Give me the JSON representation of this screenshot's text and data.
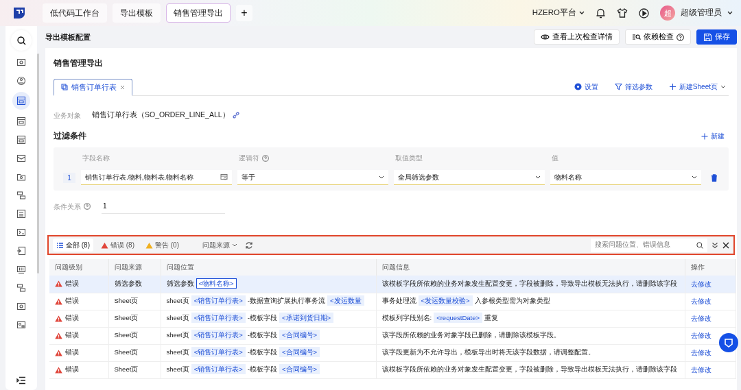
{
  "top_tabs": [
    {
      "label": "低代码工作台",
      "selected": false
    },
    {
      "label": "导出模板",
      "selected": false
    },
    {
      "label": "销售管理导出",
      "selected": true
    }
  ],
  "add_tab": "+",
  "platform": "HZERO平台",
  "user": {
    "avatar": "超",
    "name": "超级管理员"
  },
  "sidebar": {
    "items": [
      {
        "selected": false
      },
      {
        "selected": false
      },
      {
        "selected": true
      },
      {
        "selected": false
      },
      {
        "selected": false
      },
      {
        "selected": false
      },
      {
        "selected": false
      },
      {
        "selected": false
      },
      {
        "selected": false
      },
      {
        "selected": false
      },
      {
        "selected": false
      },
      {
        "selected": false
      },
      {
        "selected": false
      },
      {
        "selected": false
      },
      {
        "selected": false
      }
    ]
  },
  "page_title": "导出模板配置",
  "actions": [
    {
      "label": "查看上次检查详情",
      "kind": "eye"
    },
    {
      "label": "依赖检查",
      "kind": "check"
    },
    {
      "label": "保存",
      "kind": "primary"
    }
  ],
  "section_title": "销售管理导出",
  "sheet_tabs": [
    {
      "label": "销售订单行表",
      "selected": true
    }
  ],
  "sheet_actions": [
    {
      "label": "设置",
      "kind": "settings"
    },
    {
      "label": "筛选参数",
      "kind": "filter"
    },
    {
      "label": "新建Sheet页",
      "kind": "add"
    }
  ],
  "business_object": {
    "label": "业务对象",
    "value": "销售订单行表（SO_ORDER_LINE_ALL）"
  },
  "filter": {
    "title": "过滤条件",
    "add": "新建",
    "columns": [
      {
        "label": "字段名称",
        "help": false
      },
      {
        "label": "逻辑符",
        "help": true
      },
      {
        "label": "取值类型",
        "help": false
      },
      {
        "label": "值",
        "help": false
      }
    ],
    "rows": [
      {
        "index": "1",
        "field": "销售订单行表.物料,物料表.物料名称",
        "logic": "等于",
        "value_type": "全局筛选参数",
        "value": "物料名称"
      }
    ],
    "relation_label": "条件关系",
    "relation_value": "1"
  },
  "issues": {
    "filters": [
      {
        "label": "全部 (8)",
        "kind": "all",
        "selected": true
      },
      {
        "label": "错误 (8)",
        "kind": "error",
        "selected": false
      },
      {
        "label": "警告 (0)",
        "kind": "warning",
        "selected": false
      }
    ],
    "source_filter": "问题来源",
    "search_placeholder": "搜索问题位置、错误信息",
    "columns": [
      "问题级别",
      "问题来源",
      "问题位置",
      "问题信息",
      "操作"
    ],
    "rows": [
      {
        "level": "错误",
        "kind": "error",
        "source": "筛选参数",
        "selected": true,
        "location": [
          {
            "kind": "text",
            "text": "筛选参数"
          },
          {
            "kind": "tag",
            "text": "<物料名称>"
          }
        ],
        "message": [
          {
            "kind": "text",
            "text": "该模板字段所依赖的业务对象发生配置变更，字段被删除，导致导出模板无法执行，请删除该字段"
          }
        ],
        "action": "去修改"
      },
      {
        "level": "错误",
        "kind": "error",
        "source": "Sheet页",
        "selected": false,
        "location": [
          {
            "kind": "text",
            "text": "sheet页"
          },
          {
            "kind": "tag",
            "text": "<销售订单行表>"
          },
          {
            "kind": "text",
            "text": "-数据查询扩展执行事务流"
          },
          {
            "kind": "tag",
            "text": "<发运数量"
          }
        ],
        "message": [
          {
            "kind": "text",
            "text": "事务处理流"
          },
          {
            "kind": "tag",
            "text": "<发运数量校验>"
          },
          {
            "kind": "text",
            "text": "入参根类型需为对象类型"
          }
        ],
        "action": "去修改"
      },
      {
        "level": "错误",
        "kind": "error",
        "source": "Sheet页",
        "selected": false,
        "location": [
          {
            "kind": "text",
            "text": "sheet页"
          },
          {
            "kind": "tag",
            "text": "<销售订单行表>"
          },
          {
            "kind": "text",
            "text": "-模板字段"
          },
          {
            "kind": "tag",
            "text": "<承诺到货日期>"
          }
        ],
        "message": [
          {
            "kind": "text",
            "text": "模板列字段别名:"
          },
          {
            "kind": "tag",
            "text": "<requestDate>"
          },
          {
            "kind": "text",
            "text": "重复"
          }
        ],
        "action": "去修改"
      },
      {
        "level": "错误",
        "kind": "error",
        "source": "Sheet页",
        "selected": false,
        "location": [
          {
            "kind": "text",
            "text": "sheet页"
          },
          {
            "kind": "tag",
            "text": "<销售订单行表>"
          },
          {
            "kind": "text",
            "text": "-模板字段"
          },
          {
            "kind": "tag",
            "text": "<合同编号>"
          }
        ],
        "message": [
          {
            "kind": "text",
            "text": "该字段所依赖的业务对象字段已删除，请删除该模板字段。"
          }
        ],
        "action": "去修改"
      },
      {
        "level": "错误",
        "kind": "error",
        "source": "Sheet页",
        "selected": false,
        "location": [
          {
            "kind": "text",
            "text": "sheet页"
          },
          {
            "kind": "tag",
            "text": "<销售订单行表>"
          },
          {
            "kind": "text",
            "text": "-模板字段"
          },
          {
            "kind": "tag",
            "text": "<合同编号>"
          }
        ],
        "message": [
          {
            "kind": "text",
            "text": "该字段更新为不允许导出，模板导出时将无该字段数据，请调整配置。"
          }
        ],
        "action": "去修改"
      },
      {
        "level": "错误",
        "kind": "error",
        "source": "Sheet页",
        "selected": false,
        "location": [
          {
            "kind": "text",
            "text": "sheet页"
          },
          {
            "kind": "tag",
            "text": "<销售订单行表>"
          },
          {
            "kind": "text",
            "text": "-模板字段"
          },
          {
            "kind": "tag",
            "text": "<合同编号>"
          }
        ],
        "message": [
          {
            "kind": "text",
            "text": "该模板字段所依赖的业务对象发生配置变更，字段被删除，导致导出模板无法执行，请删除该字段"
          }
        ],
        "action": "去修改"
      }
    ]
  }
}
